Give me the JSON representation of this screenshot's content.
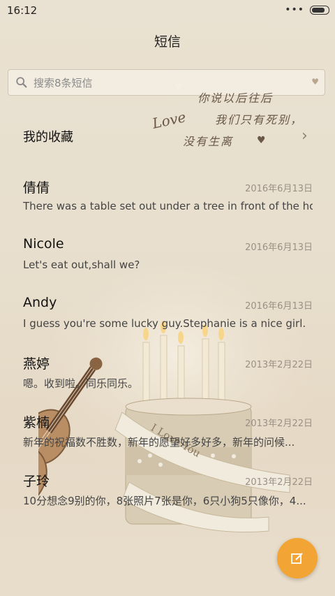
{
  "status": {
    "time": "16:12",
    "signal_dots": "•••"
  },
  "header": {
    "title": "短信"
  },
  "search": {
    "placeholder": "搜索8条短信"
  },
  "favorites": {
    "label": "我的收藏"
  },
  "decor": {
    "love": "Love",
    "line1": "你说以后往后",
    "line2": "我们只有死别，",
    "line3": "没有生离",
    "ribbon_text": "I Love You"
  },
  "threads": [
    {
      "name": "倩倩",
      "date": "2016年6月13日",
      "snippet": "There was a table set out under a tree in front of the ho.."
    },
    {
      "name": "Nicole",
      "date": "2016年6月13日",
      "snippet": "Let's eat out,shall we?"
    },
    {
      "name": "Andy",
      "date": "2016年6月13日",
      "snippet": "I guess you're some lucky guy.Stephanie is a nice girl."
    },
    {
      "name": "燕婷",
      "date": "2013年2月22日",
      "snippet": "嗯。收到啦。同乐同乐。"
    },
    {
      "name": "紫楠",
      "date": "2013年2月22日",
      "snippet": "新年的祝福数不胜数，新年的愿望好多好多，新年的问候..."
    },
    {
      "name": "子玲",
      "date": "2013年2月22日",
      "snippet": "10分想念9别的你，8张照片7张是你，6只小狗5只像你，4..."
    }
  ],
  "colors": {
    "accent": "#f2a534",
    "background": "#e8dfce"
  },
  "icons": {
    "fab": "compose-icon",
    "search": "search-icon"
  }
}
